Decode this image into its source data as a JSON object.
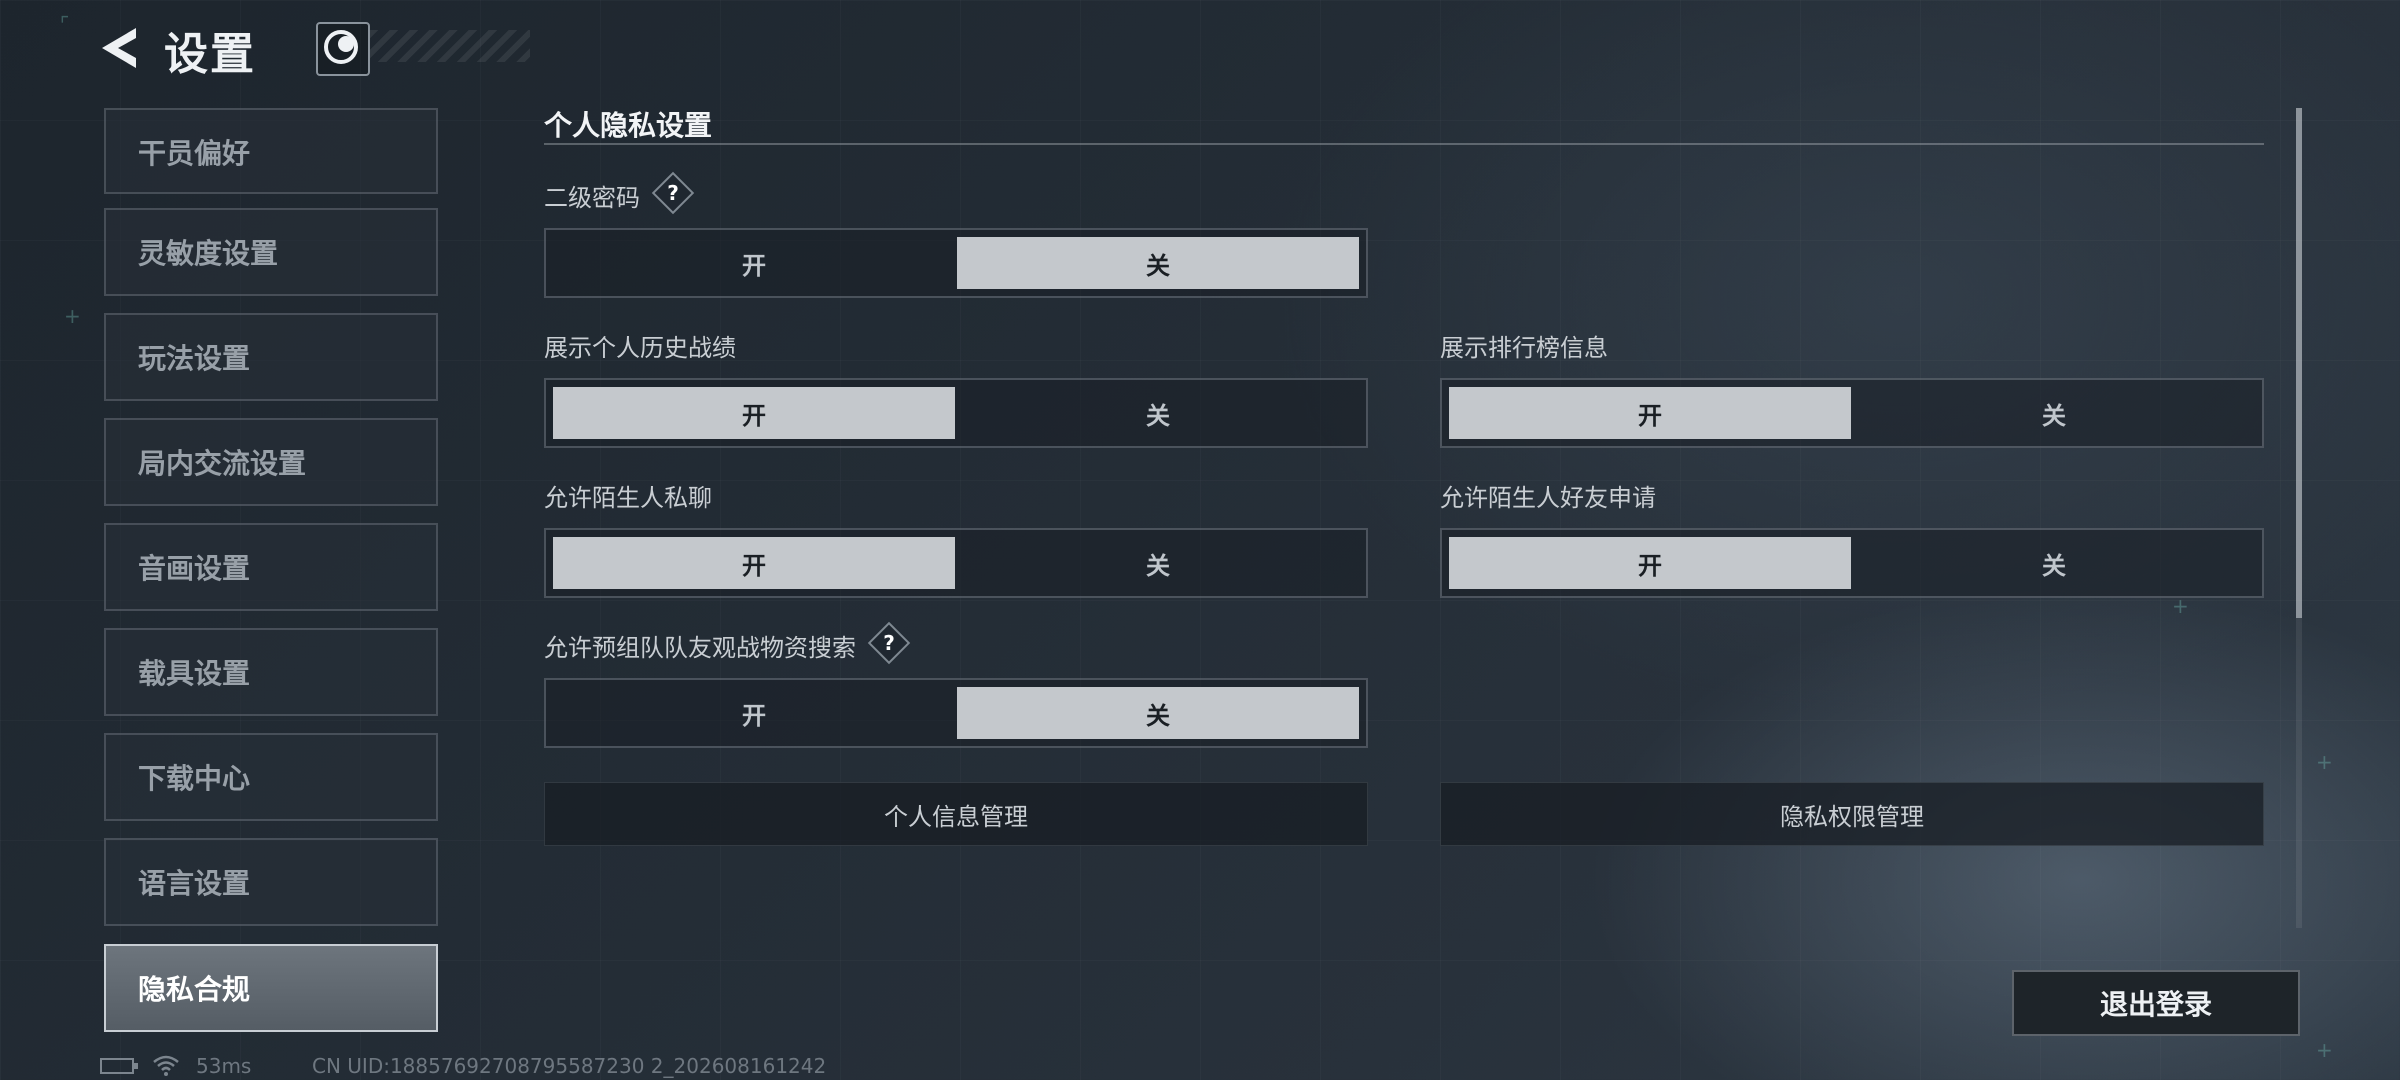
{
  "header": {
    "title": "设置",
    "back_icon": "back-arrow-icon",
    "logo_icon": "game-logo-icon"
  },
  "sidebar": {
    "items": [
      {
        "label": "干员偏好"
      },
      {
        "label": "灵敏度设置"
      },
      {
        "label": "玩法设置"
      },
      {
        "label": "局内交流设置"
      },
      {
        "label": "音画设置"
      },
      {
        "label": "载具设置"
      },
      {
        "label": "下载中心"
      },
      {
        "label": "语言设置"
      },
      {
        "label": "隐私合规",
        "active": true
      }
    ]
  },
  "privacy": {
    "section_title": "个人隐私设置",
    "on_label": "开",
    "off_label": "关",
    "settings": [
      {
        "label": "二级密码",
        "has_help": true,
        "value": "关"
      },
      {
        "label": "展示个人历史战绩",
        "value": "开"
      },
      {
        "label": "展示排行榜信息",
        "value": "开"
      },
      {
        "label": "允许陌生人私聊",
        "value": "开"
      },
      {
        "label": "允许陌生人好友申请",
        "value": "开"
      },
      {
        "label": "允许预组队队友观战物资搜索",
        "has_help": true,
        "value": "关"
      }
    ],
    "help_glyph": "?",
    "personal_info_button": "个人信息管理",
    "privacy_permission_button": "隐私权限管理"
  },
  "logout_button": "退出登录",
  "status": {
    "ping": "53ms",
    "uid": "CN UID:18857692708795587230 2_202608161242"
  },
  "colors": {
    "selected_option_bg": "#c4c8cc",
    "background": "#232c35"
  }
}
